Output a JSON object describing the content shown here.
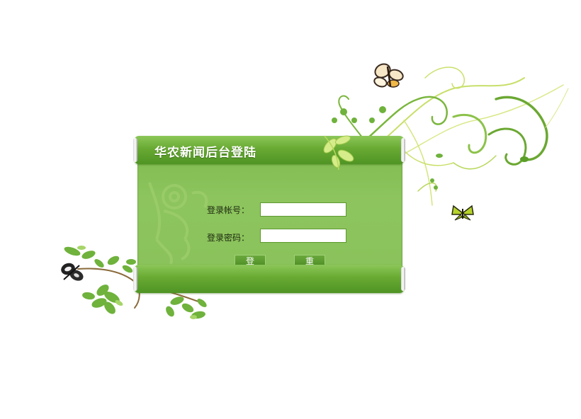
{
  "login": {
    "title": "华农新闻后台登陆",
    "account_label": "登录帐号：",
    "password_label": "登录密码：",
    "account_value": "",
    "password_value": "",
    "login_button": "登 录",
    "reset_button": "重 填"
  },
  "colors": {
    "panel_green": "#8ac25a",
    "bar_green": "#5c9e2c",
    "leaf_green": "#6fb23c",
    "vine_yellow": "#c9e06a"
  },
  "icons": [
    "butterfly-icon",
    "leaf-vine-decoration",
    "floral-ornament"
  ]
}
